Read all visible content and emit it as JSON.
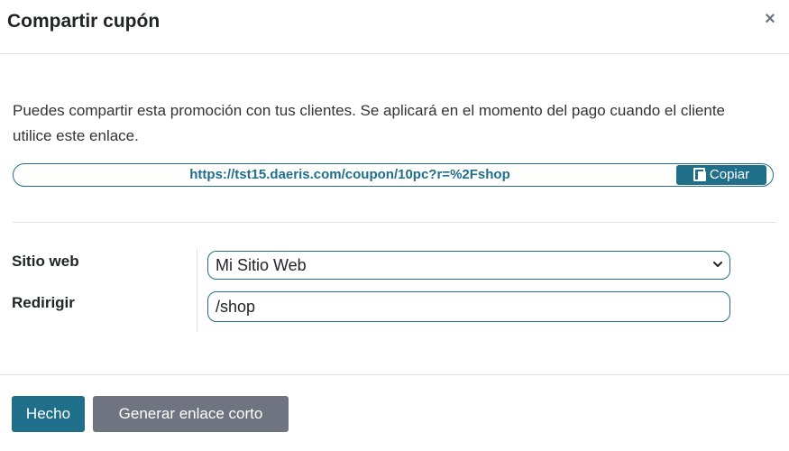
{
  "dialog": {
    "title": "Compartir cupón",
    "close_symbol": "×"
  },
  "description": "Puedes compartir esta promoción con tus clientes. Se aplicará en el momento del pago cuando el cliente utilice este enlace.",
  "share_link": {
    "url": "https://tst15.daeris.com/coupon/10pc?r=%2Fshop",
    "copy_label": "Copiar",
    "copy_icon": "copy-icon"
  },
  "form": {
    "website_label": "Sitio web",
    "website_value": "Mi Sitio Web",
    "redirect_label": "Redirigir",
    "redirect_value": "/shop"
  },
  "footer": {
    "done_label": "Hecho",
    "short_link_label": "Generar enlace corto"
  },
  "colors": {
    "accent": "#1f6f8b",
    "secondary": "#6f7480"
  }
}
